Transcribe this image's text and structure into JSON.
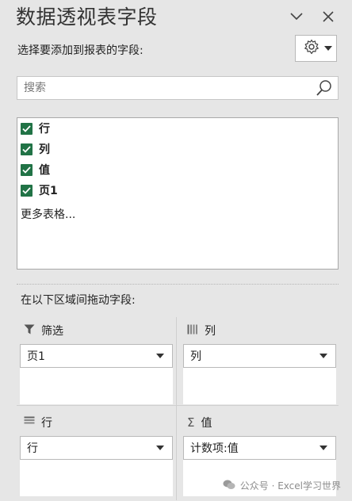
{
  "header": {
    "title": "数据透视表字段"
  },
  "choose_fields_label": "选择要添加到报表的字段:",
  "search": {
    "placeholder": "搜索",
    "value": ""
  },
  "fields": [
    {
      "label": "行",
      "checked": true
    },
    {
      "label": "列",
      "checked": true
    },
    {
      "label": "值",
      "checked": true
    },
    {
      "label": "页1",
      "checked": true
    }
  ],
  "more_tables": "更多表格...",
  "drag_label": "在以下区域间拖动字段:",
  "areas": {
    "filters": {
      "label": "筛选",
      "value": "页1",
      "icon": "filter-icon"
    },
    "columns": {
      "label": "列",
      "value": "列",
      "icon": "columns-icon"
    },
    "rows": {
      "label": "行",
      "value": "行",
      "icon": "rows-icon"
    },
    "values": {
      "label": "值",
      "value": "计数项:值",
      "icon": "sigma-icon"
    }
  },
  "watermark": "公众号 · Excel学习世界",
  "colors": {
    "checkbox": "#217346",
    "panel_bg": "#e6e6e6"
  }
}
